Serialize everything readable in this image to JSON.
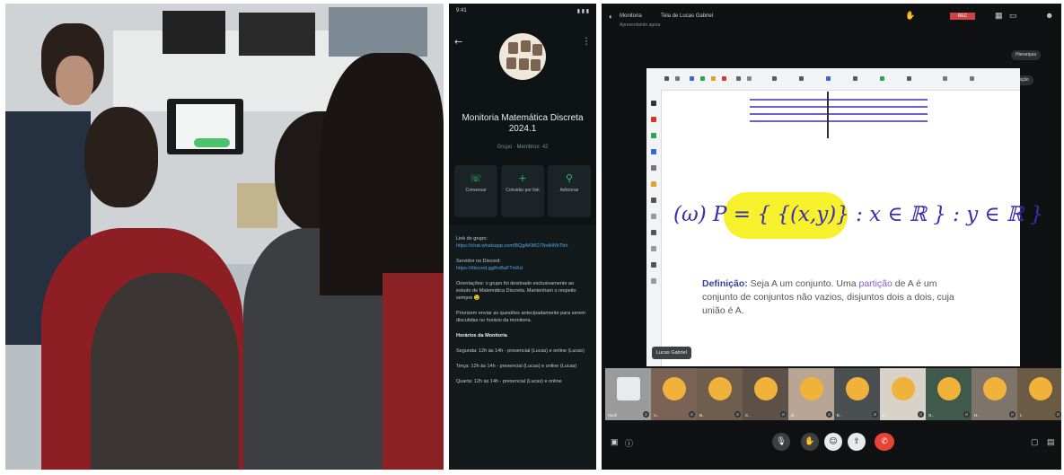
{
  "phone": {
    "status_time": "9:41",
    "status_icons": "▮ ▮ ▮",
    "group_title": "Monitoria Matemática Discreta 2024.1",
    "group_subtitle": "Grupo · Membros: 42",
    "actions": [
      {
        "icon": "phone-icon",
        "glyph": "☏",
        "label": "Conversar"
      },
      {
        "icon": "add-member-icon",
        "glyph": "+",
        "label": "Convidar por link"
      },
      {
        "icon": "add-person-icon",
        "glyph": "⚲",
        "label": "Adicionar"
      }
    ],
    "info": {
      "group_link_label": "Link do grupo:",
      "group_link": "https://chat.whatsapp.com/BQgAKMO7NvtkWbTbh",
      "discord_label": "Servidor no Discord:",
      "discord_link": "https://discord.gg/hvBaFTmKd",
      "rules": "Orientações: o grupo foi destinado exclusivamente ao estudo de Matemática Discreta. Mantenham o respeito sempre 😉",
      "reminder": "Priorizem enviar as questões antecipadamente para serem discutidas no horário da monitoria.",
      "schedule_title": "Horários da Monitoria",
      "schedule_1": "Segunda: 12h às 14h - presencial (Lucas) e online (Lucas)",
      "schedule_2": "Terça: 12h às 14h - presencial (Lucas) e online (Lucas)",
      "schedule_3": "Quarta: 12h às 14h - presencial (Lucas) e online"
    }
  },
  "meet": {
    "top": {
      "app_name": "Monitoria",
      "tab_title": "Tela de Lucas Gabriel",
      "subtitle": "Apresentando agora",
      "rec_label": "REC",
      "chip_1": "Hierarquia",
      "chip_2": "Fixar apresentação"
    },
    "whiteboard": {
      "math": "(ω) P = { {(x,y)} : x ∈ ℝ } : y ∈ ℝ }",
      "definition_label": "Definição:",
      "definition_text_1": " Seja A um conjunto. Uma ",
      "definition_term": "partição",
      "definition_text_2": " de A é um conjunto de conjuntos não vazios, disjuntos dois a dois, cuja união é A."
    },
    "presenter_tag": "Lucas Gabriel",
    "participants": [
      {
        "name": "Você",
        "color": "#9b9b9b"
      },
      {
        "name": "A..",
        "color": "#7a6255"
      },
      {
        "name": "B..",
        "color": "#6f5d4d"
      },
      {
        "name": "C..",
        "color": "#5d5147"
      },
      {
        "name": "D..",
        "color": "#b9a594"
      },
      {
        "name": "E..",
        "color": "#4a4f52"
      },
      {
        "name": "F..",
        "color": "#d8d2c8"
      },
      {
        "name": "G..",
        "color": "#3f5a4c"
      },
      {
        "name": "H..",
        "color": "#7e746a"
      },
      {
        "name": "I..",
        "color": "#6b5a44"
      }
    ],
    "controls": [
      {
        "icon": "mic-icon",
        "glyph": "🎙"
      },
      {
        "icon": "hand-icon",
        "glyph": "✋"
      },
      {
        "icon": "emoji-icon",
        "glyph": "☺"
      },
      {
        "icon": "present-icon",
        "glyph": "⇧"
      },
      {
        "icon": "end-call-icon",
        "glyph": "✆"
      }
    ]
  }
}
